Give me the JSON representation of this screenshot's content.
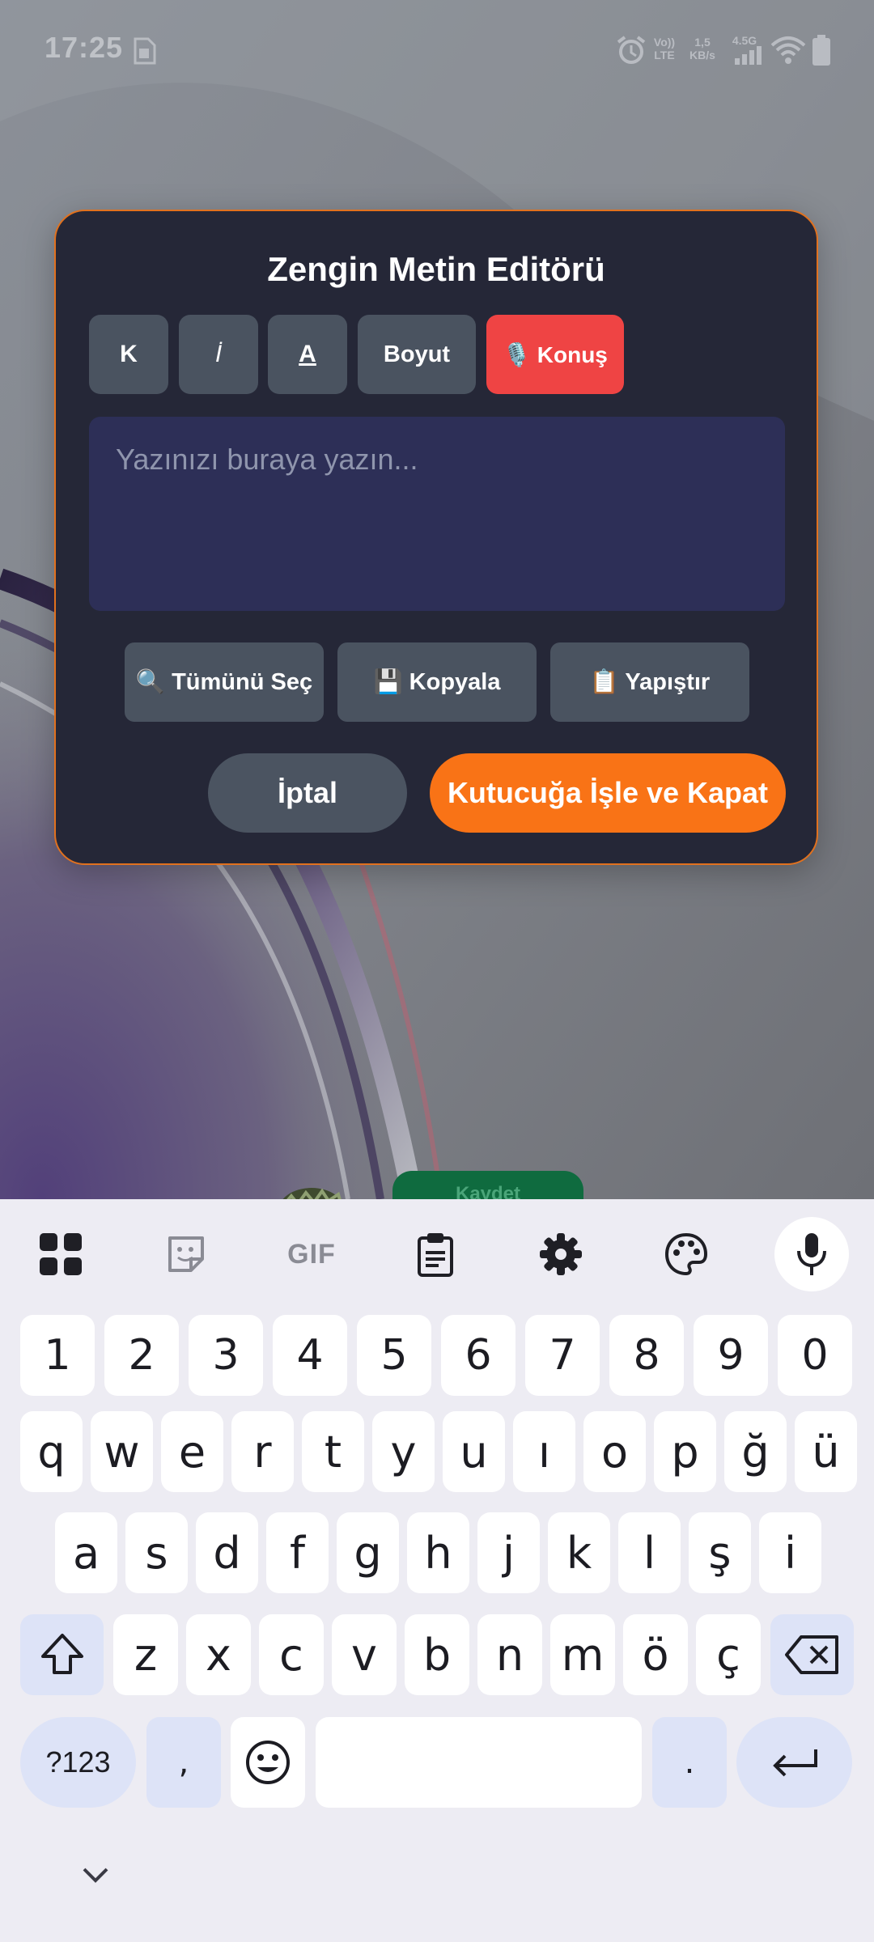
{
  "status_bar": {
    "time": "17:25",
    "volte_label": "Vo))",
    "lte_label": "LTE",
    "speed_value": "1,5",
    "speed_unit": "KB/s",
    "network_label": "4.5G",
    "icons": [
      "sim-card-icon",
      "alarm-icon",
      "signal-icon",
      "wifi-icon",
      "battery-icon"
    ]
  },
  "dialog": {
    "title": "Zengin Metin Editörü",
    "format_buttons": {
      "bold": "K",
      "italic": "İ",
      "underline": "A",
      "size": "Boyut",
      "speak": "🎙️ Konuş"
    },
    "editor": {
      "placeholder": "Yazınızı buraya yazın...",
      "value": ""
    },
    "actions": {
      "select_all": "🔍 Tümünü Seç",
      "copy": "💾 Kopyala",
      "paste": "📋 Yapıştır"
    },
    "cancel": "İptal",
    "apply_close": "Kutucuğa İşle ve Kapat"
  },
  "background_page": {
    "save_button": "Kaydet"
  },
  "keyboard": {
    "toolbar": [
      "apps-grid-icon",
      "sticker-icon",
      "gif-icon",
      "clipboard-icon",
      "settings-gear-icon",
      "palette-icon",
      "microphone-icon"
    ],
    "gif_label": "GIF",
    "number_row": [
      "1",
      "2",
      "3",
      "4",
      "5",
      "6",
      "7",
      "8",
      "9",
      "0"
    ],
    "row1": [
      "q",
      "w",
      "e",
      "r",
      "t",
      "y",
      "u",
      "ı",
      "o",
      "p",
      "ğ",
      "ü"
    ],
    "row2": [
      "a",
      "s",
      "d",
      "f",
      "g",
      "h",
      "j",
      "k",
      "l",
      "ş",
      "i"
    ],
    "row3": [
      "z",
      "x",
      "c",
      "v",
      "b",
      "n",
      "m",
      "ö",
      "ç"
    ],
    "symbols_key": "?123",
    "comma_key": ",",
    "period_key": "."
  },
  "colors": {
    "dialog_bg": "#252737",
    "dialog_border": "#e1711e",
    "editor_bg": "#2d2f57",
    "button_bg": "#4a5360",
    "speak_button": "#ef4444",
    "primary_orange": "#f97316",
    "keyboard_bg": "#edecf3",
    "keyboard_fn_key": "#dde3f7"
  }
}
